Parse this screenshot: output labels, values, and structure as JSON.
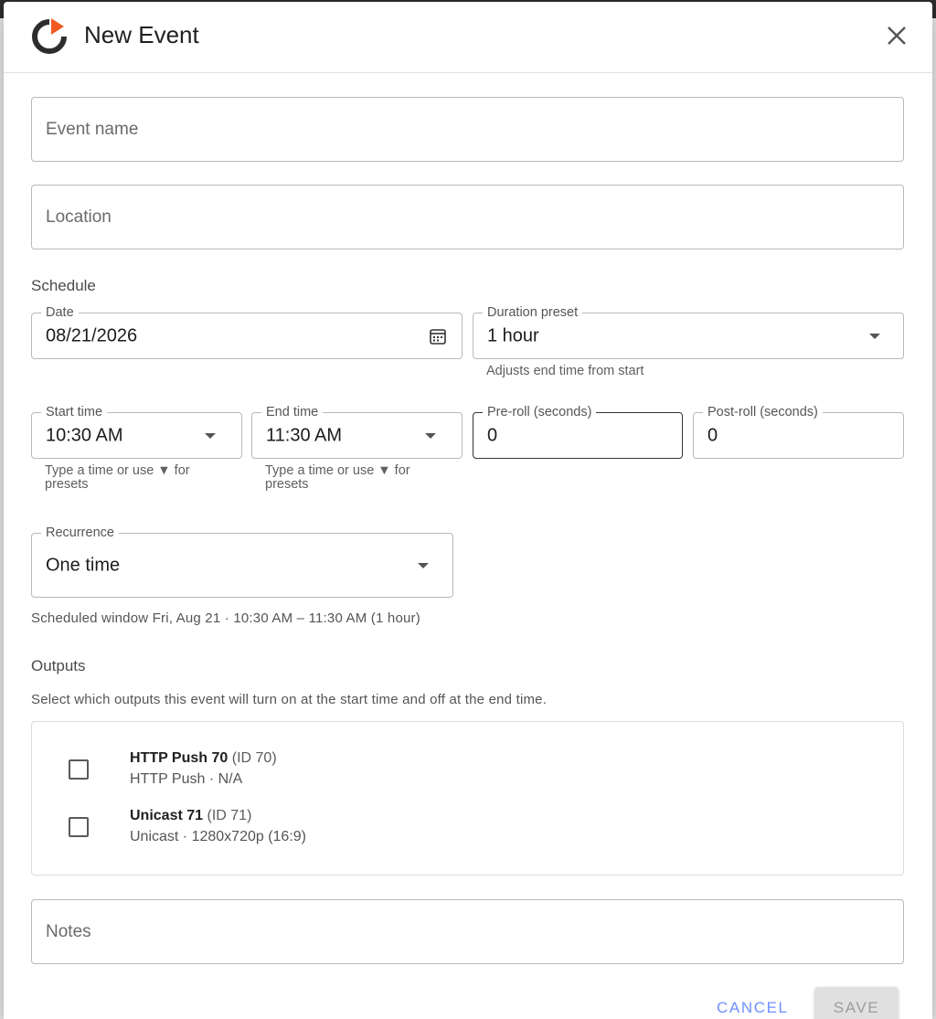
{
  "dialog": {
    "title": "New Event",
    "close_icon": "close-icon"
  },
  "fields": {
    "event_name_placeholder": "Event name",
    "location_placeholder": "Location",
    "notes_placeholder": "Notes"
  },
  "schedule": {
    "label": "Schedule",
    "date": {
      "label": "Date",
      "value": "08/21/2026",
      "icon": "calendar-icon"
    },
    "duration_preset": {
      "label": "Duration preset",
      "value": "1 hour",
      "helper": "Adjusts end time from start"
    },
    "start_time": {
      "label": "Start time",
      "value": "10:30 AM",
      "helper_line1": "Type a time or use ▼ for",
      "helper_line2": "presets"
    },
    "end_time": {
      "label": "End time",
      "value": "11:30 AM",
      "helper_line1": "Type a time or use ▼ for",
      "helper_line2": "presets"
    },
    "pre_roll": {
      "label": "Pre-roll (seconds)",
      "value": "0"
    },
    "post_roll": {
      "label": "Post-roll (seconds)",
      "value": "0"
    },
    "recurrence": {
      "label": "Recurrence",
      "value": "One time"
    },
    "summary": "Scheduled window Fri, Aug 21 · 10:30 AM – 11:30 AM (1 hour)"
  },
  "outputs": {
    "label": "Outputs",
    "description": "Select which outputs this event will turn on at the start time and off at the end time.",
    "items": [
      {
        "name": "HTTP Push 70",
        "id": "(ID 70)",
        "sub": "HTTP Push · N/A",
        "checked": false
      },
      {
        "name": "Unicast 71",
        "id": "(ID 71)",
        "sub": "Unicast · 1280x720p (16:9)",
        "checked": false
      }
    ]
  },
  "footer": {
    "cancel_label": "CANCEL",
    "save_label": "SAVE"
  },
  "colors": {
    "brand_orange": "#f05a22",
    "brand_dark": "#2d2d2d",
    "accent_blue": "#6f90ff"
  }
}
